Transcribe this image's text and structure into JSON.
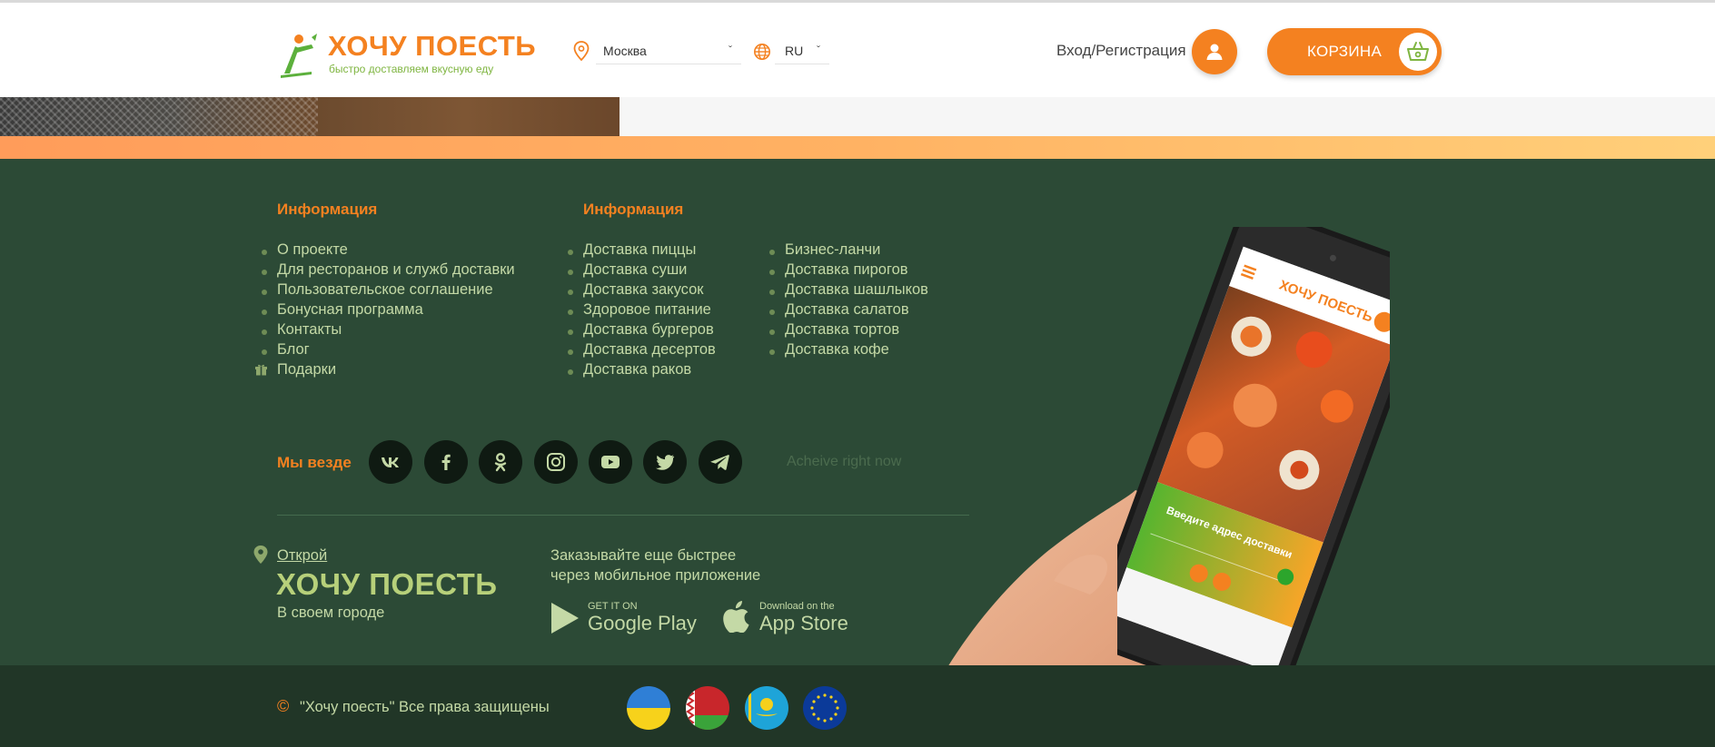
{
  "header": {
    "logo_title": "ХОЧУ ПОЕСТЬ",
    "logo_subtitle": "быстро доставляем вкусную еду",
    "city": "Москва",
    "language": "RU",
    "login_label": "Вход/Регистрация",
    "cart_label": "КОРЗИНА"
  },
  "footer": {
    "col1_title": "Информация",
    "col2_title": "Информация",
    "col1_links": [
      "О проекте",
      "Для ресторанов и служб доставки",
      "Пользовательское соглашение",
      "Бонусная программа",
      "Контакты",
      "Блог",
      "Подарки"
    ],
    "col2_links": [
      "Доставка пиццы",
      "Доставка суши",
      "Доставка закусок",
      "Здоровое питание",
      "Доставка бургеров",
      "Доставка десертов",
      "Доставка раков"
    ],
    "col3_links": [
      "Бизнес-ланчи",
      "Доставка пирогов",
      "Доставка шашлыков",
      "Доставка салатов",
      "Доставка тортов",
      "Доставка кофе"
    ],
    "social_title": "Мы везде",
    "social_icons": [
      "vk-icon",
      "facebook-icon",
      "odnoklassniki-icon",
      "instagram-icon",
      "youtube-icon",
      "twitter-icon",
      "telegram-icon"
    ],
    "achieve_text": "Acheive right now",
    "open_link": "Открой",
    "brand_big": "ХОЧУ ПОЕСТЬ",
    "city_sub": "В своем городе",
    "app_text_line1": "Заказывайте еще быстрее",
    "app_text_line2": "через мобильное приложение",
    "google_play_small": "GET IT ON",
    "google_play_big": "Google Play",
    "app_store_small": "Download on the",
    "app_store_big": "App Store",
    "copyright_symbol": "©",
    "copyright_text": "\"Хочу поесть\" Все права защищены",
    "flags": [
      "ukraine-flag",
      "belarus-flag",
      "kazakhstan-flag",
      "eu-flag"
    ]
  },
  "phone_screen": {
    "logo_text": "ХОЧУ ПОЕСТЬ",
    "address_prompt": "Введите адрес доставки"
  },
  "colors": {
    "accent": "#f48120",
    "footer_bg": "#2c4a36",
    "bottom_bar_bg": "#213627",
    "link": "#c4d9a6",
    "brand_green": "#b7d07a"
  }
}
